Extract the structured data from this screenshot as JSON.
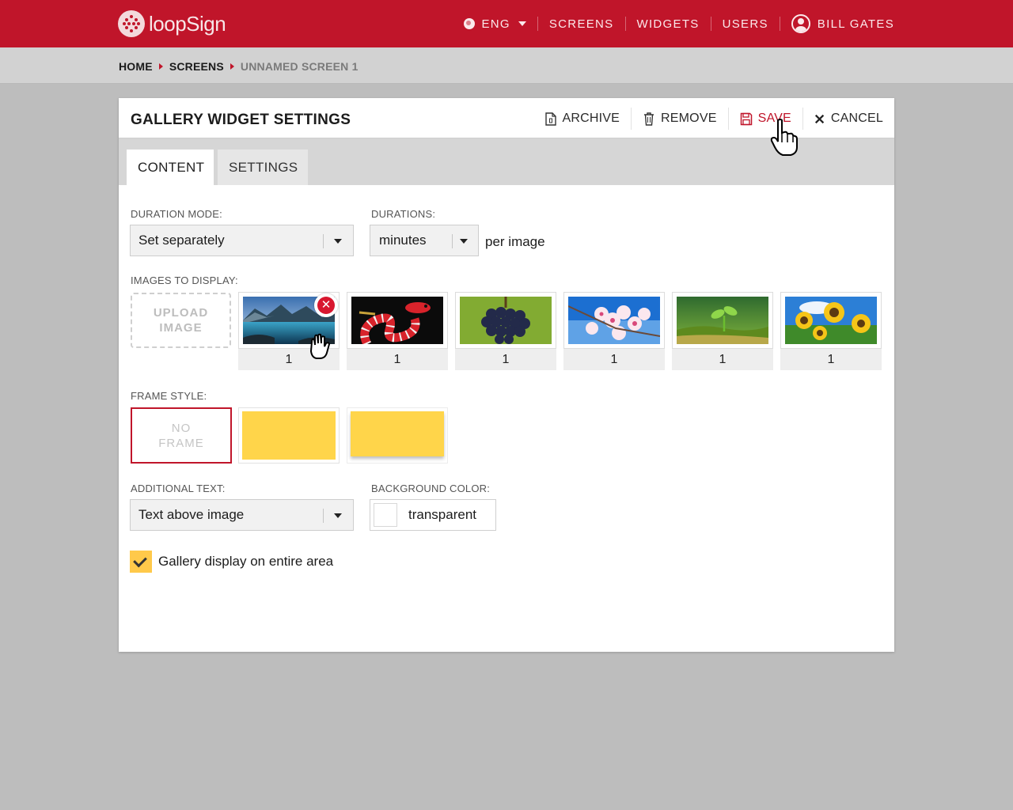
{
  "header": {
    "brand": "loopSign",
    "brand_color": "#c0152a",
    "nav": {
      "language": "ENG",
      "screens": "SCREENS",
      "widgets": "WIDGETS",
      "users": "USERS",
      "user": "BILL GATES"
    }
  },
  "breadcrumb": {
    "items": [
      "HOME",
      "SCREENS",
      "UNNAMED SCREEN 1"
    ]
  },
  "panel": {
    "title": "GALLERY WIDGET SETTINGS",
    "actions": {
      "archive": "ARCHIVE",
      "remove": "REMOVE",
      "save": "SAVE",
      "cancel": "CANCEL"
    },
    "tabs": {
      "content": "CONTENT",
      "settings": "SETTINGS"
    },
    "active_tab": "CONTENT"
  },
  "form": {
    "duration_mode": {
      "label": "DURATION MODE:",
      "value": "Set separately"
    },
    "durations": {
      "label": "DURATIONS:",
      "value": "minutes",
      "suffix": "per image"
    },
    "images": {
      "label": "IMAGES TO DISPLAY:",
      "upload_label": "UPLOAD IMAGE",
      "items": [
        {
          "subject": "lake-landscape",
          "duration": "1"
        },
        {
          "subject": "snake",
          "duration": "1"
        },
        {
          "subject": "grapes",
          "duration": "1"
        },
        {
          "subject": "cherry-blossom",
          "duration": "1"
        },
        {
          "subject": "seedling",
          "duration": "1"
        },
        {
          "subject": "sunflowers",
          "duration": "1"
        }
      ]
    },
    "frame_style": {
      "label": "FRAME STYLE:",
      "no_frame_label": "NO FRAME",
      "selected": "NO FRAME",
      "swatch_color": "#ffd54a"
    },
    "additional_text": {
      "label": "ADDITIONAL TEXT:",
      "value": "Text above image"
    },
    "background_color": {
      "label": "BACKGROUND COLOR:",
      "value": "transparent"
    },
    "gallery_entire_area": {
      "label": "Gallery display on entire area",
      "checked": true
    }
  }
}
